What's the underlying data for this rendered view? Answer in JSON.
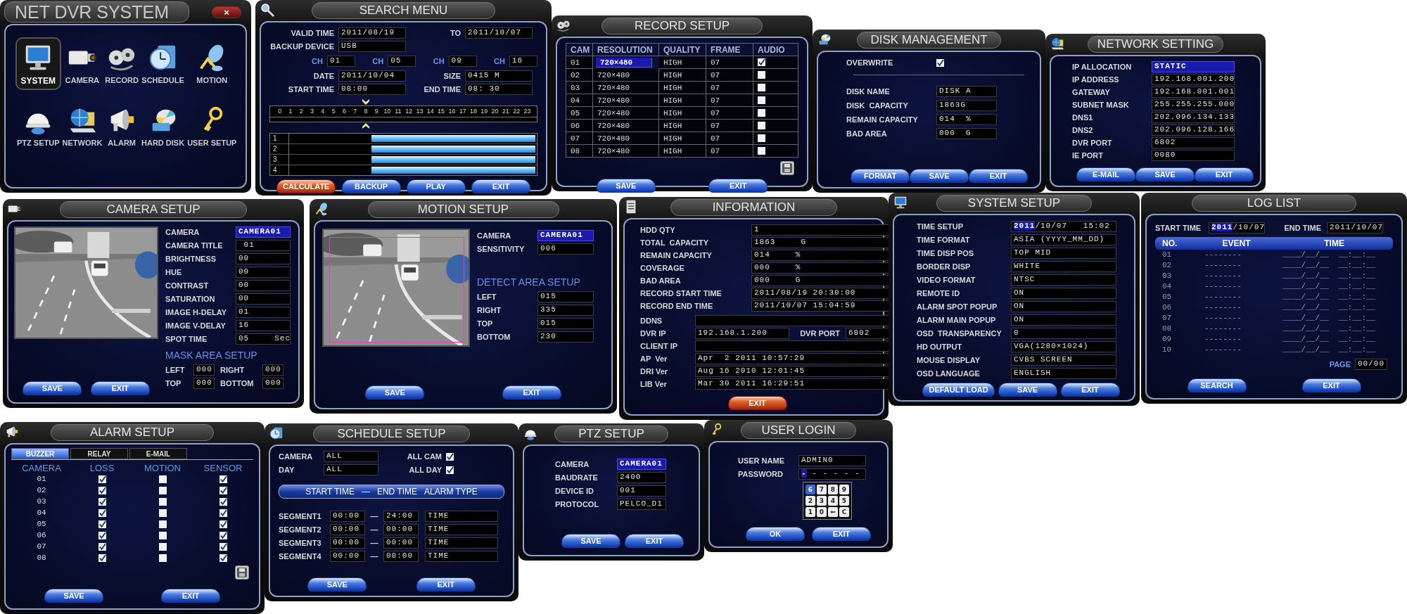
{
  "panels": [
    {
      "kind": "main",
      "title": "NET DVR SYSTEM",
      "close": "×",
      "blocks": [
        {
          "kind": "launcher",
          "items": [
            {
              "label": "SYSTEM",
              "selected": true
            },
            {
              "label": "CAMERA",
              "selected": false
            },
            {
              "label": "RECORD",
              "selected": false
            },
            {
              "label": "SCHEDULE",
              "selected": false
            },
            {
              "label": "MOTION",
              "selected": false
            },
            {
              "label": "PTZ SETUP",
              "selected": false
            },
            {
              "label": "NETWORK",
              "selected": false
            },
            {
              "label": "ALARM",
              "selected": false
            },
            {
              "label": "HARD DISK",
              "selected": false
            },
            {
              "label": "USER SETUP",
              "selected": false
            }
          ]
        }
      ]
    },
    {
      "kind": "dialog",
      "title": "SEARCH MENU",
      "blocks": [
        {
          "kind": "fields",
          "items": [
            {
              "kind": "pair",
              "label": "VALID TIME",
              "value": "2011/08/19",
              "label_2": "TO",
              "value_2": "2011/10/07"
            },
            {
              "kind": "text",
              "label": "BACKUP DEVICE",
              "value": "USB"
            }
          ]
        },
        {
          "kind": "inline",
          "items": [
            {
              "label": "CH",
              "value": "01"
            },
            {
              "label": "CH",
              "value": "05"
            },
            {
              "label": "CH",
              "value": "09"
            },
            {
              "label": "CH",
              "value": "16"
            }
          ]
        },
        {
          "kind": "fields",
          "items": [
            {
              "kind": "pair",
              "label": "DATE",
              "value": "2011/10/04",
              "label_2": "SIZE",
              "value_2": "0415 M"
            },
            {
              "kind": "pair",
              "label": "START TIME",
              "value": "08:00",
              "label_2": "END TIME",
              "value_2": "08: 30"
            }
          ]
        },
        {
          "kind": "timeline",
          "hours": [
            "0",
            "1",
            "2",
            "3",
            "4",
            "5",
            "6",
            "7",
            "8",
            "9",
            "10",
            "11",
            "12",
            "13",
            "14",
            "15",
            "16",
            "17",
            "18",
            "19",
            "20",
            "21",
            "22",
            "23"
          ],
          "level": 0.333
        },
        {
          "kind": "bars",
          "items": [
            {
              "label": "1",
              "level": 0.667
            },
            {
              "label": "2",
              "level": 0.667
            },
            {
              "label": "3",
              "level": 0.667
            },
            {
              "label": "4",
              "level": 0.667
            }
          ]
        },
        {
          "kind": "buttons",
          "items": [
            {
              "label": "CALCULATE",
              "kind": "accent"
            },
            {
              "label": "BACKUP",
              "kind": "normal"
            },
            {
              "label": "PLAY",
              "kind": "normal"
            },
            {
              "label": "EXIT",
              "kind": "normal"
            }
          ]
        }
      ]
    },
    {
      "kind": "dialog",
      "title": "RECORD SETUP",
      "blocks": [
        {
          "kind": "table",
          "columns": [
            "CAM",
            "RESOLUTION",
            "QUALITY",
            "FRAME",
            "AUDIO"
          ],
          "rows": [
            {
              "cells": [
                "01",
                "720×480",
                "HIGH",
                "07"
              ],
              "checks": [
                true
              ],
              "focused": true
            },
            {
              "cells": [
                "02",
                "720×480",
                "HIGH",
                "07"
              ],
              "checks": [
                false
              ],
              "focused": false
            },
            {
              "cells": [
                "03",
                "720×480",
                "HIGH",
                "07"
              ],
              "checks": [
                false
              ],
              "focused": false
            },
            {
              "cells": [
                "04",
                "720×480",
                "HIGH",
                "07"
              ],
              "checks": [
                false
              ],
              "focused": false
            },
            {
              "cells": [
                "05",
                "720×480",
                "HIGH",
                "07"
              ],
              "checks": [
                false
              ],
              "focused": false
            },
            {
              "cells": [
                "06",
                "720×480",
                "HIGH",
                "07"
              ],
              "checks": [
                false
              ],
              "focused": false
            },
            {
              "cells": [
                "07",
                "720×480",
                "HIGH",
                "07"
              ],
              "checks": [
                false
              ],
              "focused": false
            },
            {
              "cells": [
                "08",
                "720×480",
                "HIGH",
                "07"
              ],
              "checks": [
                false
              ],
              "focused": false
            }
          ]
        },
        {
          "kind": "icon_button"
        },
        {
          "kind": "buttons",
          "items": [
            {
              "label": "SAVE",
              "kind": "normal"
            },
            {
              "label": "EXIT",
              "kind": "normal"
            }
          ]
        }
      ]
    },
    {
      "kind": "dialog",
      "title": "DISK MANAGEMENT",
      "blocks": [
        {
          "kind": "fields",
          "items": [
            {
              "kind": "check",
              "label": "OVERWRITE",
              "checked": true
            }
          ]
        },
        {
          "kind": "divider"
        },
        {
          "kind": "fields",
          "items": [
            {
              "kind": "text",
              "label": "DISK NAME",
              "value": "DISK A"
            },
            {
              "kind": "text",
              "label": "DISK  CAPACITY",
              "value": "1863G"
            },
            {
              "kind": "text",
              "label": "REMAIN CAPACITY",
              "value": "014  %"
            },
            {
              "kind": "text",
              "label": "BAD AREA",
              "value": "000  G"
            }
          ]
        },
        {
          "kind": "buttons",
          "items": [
            {
              "label": "FORMAT",
              "kind": "normal"
            },
            {
              "label": "SAVE",
              "kind": "normal"
            },
            {
              "label": "EXIT",
              "kind": "normal"
            }
          ]
        }
      ]
    },
    {
      "kind": "dialog",
      "title": "NETWORK SETTING",
      "blocks": [
        {
          "kind": "fields",
          "items": [
            {
              "kind": "text",
              "label": "IP ALLOCATION",
              "value": "STATIC",
              "focused": true
            },
            {
              "kind": "text",
              "label": "IP ADDRESS",
              "value": "192.168.001.200",
              "focused": false
            },
            {
              "kind": "text",
              "label": "GATEWAY",
              "value": "192.168.001.001",
              "focused": false
            },
            {
              "kind": "text",
              "label": "SUBNET MASK",
              "value": "255.255.255.000",
              "focused": false
            },
            {
              "kind": "text",
              "label": "DNS1",
              "value": "202.096.134.133",
              "focused": false
            },
            {
              "kind": "text",
              "label": "DNS2",
              "value": "202.096.128.166",
              "focused": false
            },
            {
              "kind": "text",
              "label": "DVR PORT",
              "value": "6802",
              "focused": false
            },
            {
              "kind": "text",
              "label": "IE PORT",
              "value": "0080",
              "focused": false
            }
          ]
        },
        {
          "kind": "buttons",
          "items": [
            {
              "label": "E-MAIL",
              "kind": "normal"
            },
            {
              "label": "SAVE",
              "kind": "normal"
            },
            {
              "label": "EXIT",
              "kind": "normal"
            }
          ]
        }
      ]
    },
    {
      "kind": "dialog",
      "title": "CAMERA SETUP",
      "blocks": [
        {
          "kind": "split",
          "left": [
            {
              "kind": "picture",
              "detect_area": false
            },
            {
              "kind": "buttons",
              "items": [
                {
                  "label": "SAVE",
                  "kind": "normal"
                },
                {
                  "label": "EXIT",
                  "kind": "normal"
                }
              ]
            }
          ],
          "right": [
            {
              "kind": "fields",
              "items": [
                {
                  "kind": "text",
                  "label": "CAMERA",
                  "value": "CAMERA01",
                  "focused": true
                },
                {
                  "kind": "text",
                  "label": "CAMERA TITLE",
                  "value": " 01",
                  "focused": false
                },
                {
                  "kind": "text",
                  "label": "BRIGHTNESS",
                  "value": "00",
                  "focused": false
                },
                {
                  "kind": "text",
                  "label": "HUE",
                  "value": "00",
                  "focused": false
                },
                {
                  "kind": "text",
                  "label": "CONTRAST",
                  "value": "00",
                  "focused": false
                },
                {
                  "kind": "text",
                  "label": "SATURATION",
                  "value": "00",
                  "focused": false
                },
                {
                  "kind": "text",
                  "label": "IMAGE H-DELAY",
                  "value": "01",
                  "focused": false
                },
                {
                  "kind": "text",
                  "label": "IMAGE V-DELAY",
                  "value": "16",
                  "focused": false
                },
                {
                  "kind": "text",
                  "label": "SPOT TIME",
                  "value": "05",
                  "unit": "Sec",
                  "focused": false
                }
              ]
            },
            {
              "kind": "heading",
              "text": "MASK AREA SETUP"
            },
            {
              "kind": "fields",
              "items": [
                {
                  "kind": "pair",
                  "label": "LEFT",
                  "value": "000",
                  "label_2": "RIGHT",
                  "value_2": "000"
                },
                {
                  "kind": "pair",
                  "label": "TOP",
                  "value": "000",
                  "label_2": "BOTTOM",
                  "value_2": "000"
                }
              ]
            }
          ]
        }
      ]
    },
    {
      "kind": "dialog",
      "title": "MOTION SETUP",
      "blocks": [
        {
          "kind": "split",
          "left": [
            {
              "kind": "picture",
              "detect_area": true
            }
          ],
          "right": [
            {
              "kind": "fields",
              "items": [
                {
                  "kind": "text",
                  "label": "CAMERA",
                  "value": "CAMERA01",
                  "focused": true
                },
                {
                  "kind": "text",
                  "label": "SENSITIVITY",
                  "value": "006",
                  "focused": false
                }
              ]
            },
            {
              "kind": "heading",
              "text": "DETECT AREA SETUP"
            },
            {
              "kind": "fields",
              "items": [
                {
                  "kind": "text",
                  "label": "LEFT",
                  "value": "015"
                },
                {
                  "kind": "text",
                  "label": "RIGHT",
                  "value": "335"
                },
                {
                  "kind": "text",
                  "label": "TOP",
                  "value": "015"
                },
                {
                  "kind": "text",
                  "label": "BOTTOM",
                  "value": "230"
                }
              ]
            }
          ]
        },
        {
          "kind": "buttons",
          "items": [
            {
              "label": "SAVE",
              "kind": "normal"
            },
            {
              "label": "EXIT",
              "kind": "normal"
            }
          ]
        }
      ]
    },
    {
      "kind": "dialog",
      "title": "INFORMATION",
      "blocks": [
        {
          "kind": "fields",
          "items": [
            {
              "kind": "text",
              "label": "HDD QTY",
              "value": "1"
            },
            {
              "kind": "text",
              "label": "TOTAL  CAPACITY",
              "value": "1863",
              "unit": "G"
            },
            {
              "kind": "text",
              "label": "REMAIN CAPACITY",
              "value": "014",
              "unit": "%"
            },
            {
              "kind": "text",
              "label": "COVERAGE",
              "value": "000",
              "unit": "%"
            },
            {
              "kind": "text",
              "label": "BAD AREA",
              "value": "000",
              "unit": "G"
            },
            {
              "kind": "text",
              "label": "RECORD START TIME",
              "value": "2011/08/19 20:30:00"
            },
            {
              "kind": "text",
              "label": "RECORD END TIME",
              "value": "2011/10/07 15:04:59"
            }
          ]
        },
        {
          "kind": "fields",
          "items": [
            {
              "kind": "text",
              "label": "DDNS"
            },
            {
              "kind": "pair",
              "label": "DVR IP",
              "value": "192.168.1.200",
              "label_2": "DVR PORT",
              "value_2": "6802"
            },
            {
              "kind": "text",
              "label": "CLIENT IP"
            },
            {
              "kind": "text",
              "label": "AP  Ver",
              "value": "Apr  2 2011 10:57:29"
            },
            {
              "kind": "text",
              "label": "DRI Ver",
              "value": "Aug 16 2010 12:01:45"
            },
            {
              "kind": "text",
              "label": "LIB Ver",
              "value": "Mar 30 2011 16:29:51"
            }
          ]
        },
        {
          "kind": "buttons",
          "items": [
            {
              "label": "EXIT",
              "kind": "accent"
            }
          ]
        }
      ]
    },
    {
      "kind": "dialog",
      "title": "SYSTEM SETUP",
      "blocks": [
        {
          "kind": "fields",
          "items": [
            {
              "kind": "text",
              "label": "TIME SETUP",
              "lead": "2011",
              "value": "/10/07   15:02"
            },
            {
              "kind": "text",
              "label": "TIME FORMAT",
              "value": "ASIA (YYYY_MM_DD)"
            },
            {
              "kind": "text",
              "label": "TIME DISP POS",
              "value": "TOP MID"
            },
            {
              "kind": "text",
              "label": "BORDER DISP",
              "value": "WHITE"
            },
            {
              "kind": "text",
              "label": "VIDEO FORMAT",
              "value": "NTSC"
            },
            {
              "kind": "text",
              "label": "REMOTE ID",
              "value": "ON"
            },
            {
              "kind": "text",
              "label": "ALARM SPOT POPUP",
              "value": "ON"
            },
            {
              "kind": "text",
              "label": "ALARM MAIN POPUP",
              "value": "ON"
            },
            {
              "kind": "text",
              "label": "OSD  TRANSPARENCY",
              "value": "0"
            },
            {
              "kind": "text",
              "label": "HD OUTPUT",
              "value": "VGA(1280×1024)"
            },
            {
              "kind": "text",
              "label": "MOUSE DISPLAY",
              "value": "CVBS SCREEN"
            },
            {
              "kind": "text",
              "label": "OSD LANGUAGE",
              "value": "ENGLISH"
            }
          ]
        },
        {
          "kind": "buttons",
          "items": [
            {
              "label": "DEFAULT LOAD",
              "kind": "normal"
            },
            {
              "label": "SAVE",
              "kind": "normal"
            },
            {
              "label": "EXIT",
              "kind": "normal"
            }
          ]
        }
      ]
    },
    {
      "kind": "dialog",
      "title": "LOG LIST",
      "blocks": [
        {
          "kind": "fields",
          "items": [
            {
              "kind": "pair",
              "label": "START TIME",
              "lead": "2011",
              "value": "/10/07",
              "label_2": "END TIME",
              "value_2": "2011/10/07"
            }
          ]
        },
        {
          "kind": "table",
          "columns": [
            "NO.",
            "EVENT",
            "TIME"
          ],
          "rows": [
            {
              "cells": [
                "01",
                "--------",
                "____/__/__  __:__:__"
              ]
            },
            {
              "cells": [
                "02",
                "--------",
                "____/__/__  __:__:__"
              ]
            },
            {
              "cells": [
                "03",
                "--------",
                "____/__/__  __:__:__"
              ]
            },
            {
              "cells": [
                "04",
                "--------",
                "____/__/__  __:__:__"
              ]
            },
            {
              "cells": [
                "05",
                "--------",
                "____/__/__  __:__:__"
              ]
            },
            {
              "cells": [
                "06",
                "--------",
                "____/__/__  __:__:__"
              ]
            },
            {
              "cells": [
                "07",
                "--------",
                "____/__/__  __:__:__"
              ]
            },
            {
              "cells": [
                "08",
                "--------",
                "____/__/__  __:__:__"
              ]
            },
            {
              "cells": [
                "09",
                "--------",
                "____/__/__  __:__:__"
              ]
            },
            {
              "cells": [
                "10",
                "--------",
                "____/__/__  __:__:__"
              ]
            }
          ]
        },
        {
          "kind": "inline",
          "items": [
            {
              "label": "PAGE",
              "value": "00/00"
            }
          ]
        },
        {
          "kind": "buttons",
          "items": [
            {
              "label": "SEARCH",
              "kind": "normal"
            },
            {
              "label": "EXIT",
              "kind": "normal"
            }
          ]
        }
      ]
    },
    {
      "kind": "dialog",
      "title": "ALARM SETUP",
      "blocks": [
        {
          "kind": "tabs",
          "items": [
            {
              "label": "BUZZER",
              "selected": true
            },
            {
              "label": "RELAY",
              "selected": false
            },
            {
              "label": "E-MAIL",
              "selected": false
            }
          ]
        },
        {
          "kind": "table",
          "columns": [
            "CAMERA",
            "LOSS",
            "MOTION",
            "SENSOR"
          ],
          "rows": [
            {
              "cells": [
                "01"
              ],
              "checks": [
                true,
                false,
                true
              ]
            },
            {
              "cells": [
                "02"
              ],
              "checks": [
                true,
                false,
                true
              ]
            },
            {
              "cells": [
                "03"
              ],
              "checks": [
                true,
                false,
                true
              ]
            },
            {
              "cells": [
                "04"
              ],
              "checks": [
                true,
                false,
                true
              ]
            },
            {
              "cells": [
                "05"
              ],
              "checks": [
                true,
                false,
                true
              ]
            },
            {
              "cells": [
                "06"
              ],
              "checks": [
                true,
                false,
                true
              ]
            },
            {
              "cells": [
                "07"
              ],
              "checks": [
                true,
                false,
                true
              ]
            },
            {
              "cells": [
                "08"
              ],
              "checks": [
                true,
                false,
                true
              ]
            }
          ]
        },
        {
          "kind": "icon_button"
        },
        {
          "kind": "buttons",
          "items": [
            {
              "label": "SAVE",
              "kind": "normal"
            },
            {
              "label": "EXIT",
              "kind": "normal"
            }
          ]
        }
      ]
    },
    {
      "kind": "dialog",
      "title": "SCHEDULE SETUP",
      "blocks": [
        {
          "kind": "fields",
          "items": [
            {
              "kind": "pair_check",
              "label": "CAMERA",
              "value": "ALL",
              "label_2": "ALL CAM",
              "checked": true
            },
            {
              "kind": "pair_check",
              "label": "DAY",
              "value": "ALL",
              "label_2": "ALL DAY",
              "checked": true
            }
          ]
        },
        {
          "kind": "band",
          "items": [
            "START TIME",
            "—",
            "END TIME",
            "ALARM TYPE"
          ]
        },
        {
          "kind": "segments",
          "items": [
            {
              "label": "SEGMENT1",
              "start": "00:00",
              "to": "—",
              "end": "24:00",
              "type": "TIME"
            },
            {
              "label": "SEGMENT2",
              "start": "00:00",
              "to": "—",
              "end": "00:00",
              "type": "TIME"
            },
            {
              "label": "SEGMENT3",
              "start": "00:00",
              "to": "—",
              "end": "00:00",
              "type": "TIME"
            },
            {
              "label": "SEGMENT4",
              "start": "00:00",
              "to": "—",
              "end": "00:00",
              "type": "TIME"
            }
          ]
        },
        {
          "kind": "buttons",
          "items": [
            {
              "label": "SAVE",
              "kind": "normal"
            },
            {
              "label": "EXIT",
              "kind": "normal"
            }
          ]
        }
      ]
    },
    {
      "kind": "dialog",
      "title": "PTZ SETUP",
      "blocks": [
        {
          "kind": "fields",
          "items": [
            {
              "kind": "text",
              "label": "CAMERA",
              "value": "CAMERA01",
              "focused": true
            },
            {
              "kind": "text",
              "label": "BAUDRATE",
              "value": "2400",
              "focused": false
            },
            {
              "kind": "text",
              "label": "DEVICE ID",
              "value": "001",
              "focused": false
            },
            {
              "kind": "text",
              "label": "PROTOCOL",
              "value": "PELCO_D1",
              "focused": false
            }
          ]
        },
        {
          "kind": "buttons",
          "items": [
            {
              "label": "SAVE",
              "kind": "normal"
            },
            {
              "label": "EXIT",
              "kind": "normal"
            }
          ]
        }
      ]
    },
    {
      "kind": "dialog",
      "title": "USER LOGIN",
      "blocks": [
        {
          "kind": "fields",
          "items": [
            {
              "kind": "text",
              "label": "USER NAME",
              "value": "ADMIN0"
            },
            {
              "kind": "text",
              "label": "PASSWORD",
              "lead": "-",
              "value": " - - - - -"
            }
          ]
        },
        {
          "kind": "keypad",
          "keys": [
            {
              "label": "6",
              "selected": true
            },
            {
              "label": "7",
              "selected": false
            },
            {
              "label": "8",
              "selected": false
            },
            {
              "label": "9",
              "selected": false
            },
            {
              "label": "2",
              "selected": false
            },
            {
              "label": "3",
              "selected": false
            },
            {
              "label": "4",
              "selected": false
            },
            {
              "label": "5",
              "selected": false
            },
            {
              "label": "1",
              "selected": false
            },
            {
              "label": "0",
              "selected": false
            },
            {
              "label": "⇐",
              "selected": false
            },
            {
              "label": "C",
              "selected": false
            }
          ]
        },
        {
          "kind": "buttons",
          "items": [
            {
              "label": "OK",
              "kind": "normal"
            },
            {
              "label": "EXIT",
              "kind": "normal"
            }
          ]
        }
      ]
    }
  ]
}
